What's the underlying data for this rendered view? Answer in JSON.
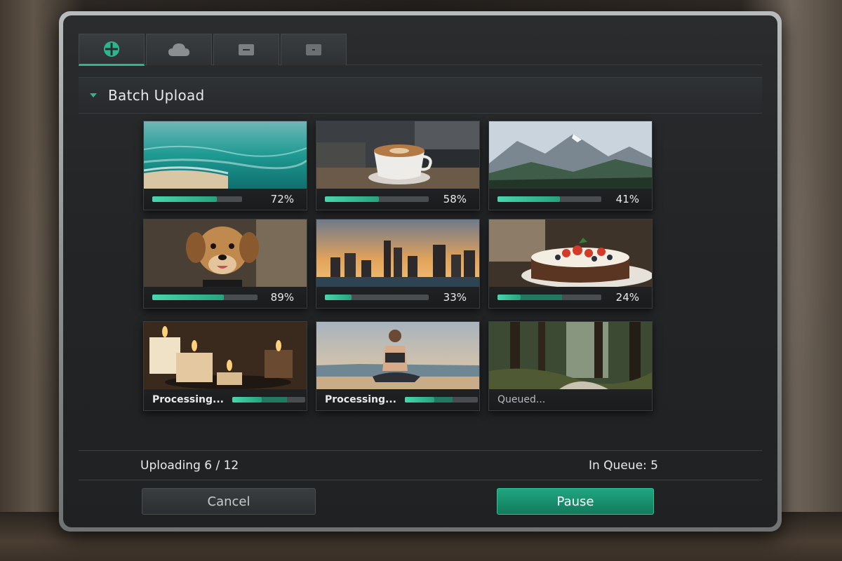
{
  "tabs": [
    {
      "icon": "plus-circle-icon",
      "active": true
    },
    {
      "icon": "cloud-icon",
      "active": false
    },
    {
      "icon": "minus-box-icon",
      "active": false
    },
    {
      "icon": "dot-box-icon",
      "active": false
    }
  ],
  "section": {
    "title": "Batch Upload"
  },
  "items": [
    {
      "subject": "ocean-beach",
      "progress": 72,
      "label": "72%"
    },
    {
      "subject": "coffee-cup",
      "progress": 58,
      "label": "58%"
    },
    {
      "subject": "mountains",
      "progress": 41,
      "label": "41%"
    },
    {
      "subject": "dog",
      "progress": 89,
      "label": "89%"
    },
    {
      "subject": "city-skyline",
      "progress": 33,
      "label": "33%"
    },
    {
      "subject": "berry-cake",
      "progress": 24,
      "label": "24%"
    },
    {
      "subject": "candles",
      "status": "Processing...",
      "progress": 75
    },
    {
      "subject": "yoga-beach",
      "status": "Processing...",
      "progress": 65
    },
    {
      "subject": "forest",
      "status": "Queued..."
    }
  ],
  "footer": {
    "uploading_label": "Uploading 6 / 12",
    "queue_label": "In Queue:",
    "queue_count": "5"
  },
  "buttons": {
    "cancel": "Cancel",
    "pause": "Pause"
  },
  "colors": {
    "accent": "#2fb58e",
    "button_primary": "#1a9472"
  }
}
